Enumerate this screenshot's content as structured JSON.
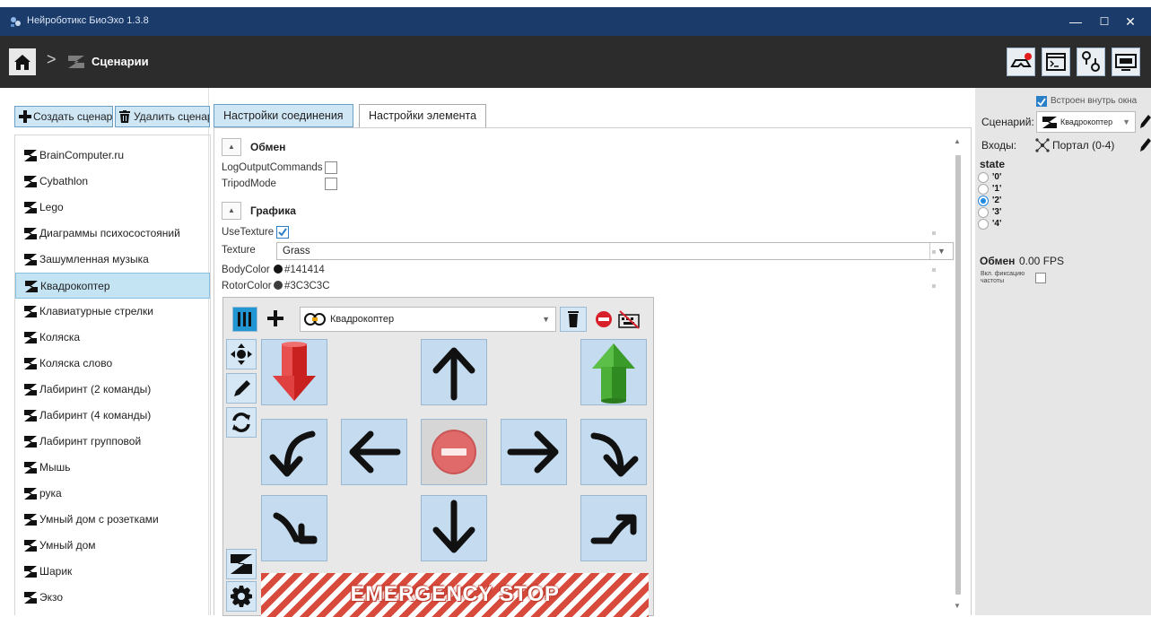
{
  "window": {
    "title": "Нейроботикс БиоЭхо 1.3.8",
    "minimize_glyph": "—",
    "maximize_glyph": "☐",
    "close_glyph": "✕"
  },
  "header": {
    "breadcrumb_separator": ">",
    "breadcrumb_title": "Сценарии",
    "home_icon": "home-icon",
    "buttons": [
      "vr-headset-icon",
      "console-icon",
      "connection-icon",
      "monitor-icon"
    ]
  },
  "sidebar": {
    "create_label": "Создать сценарий",
    "delete_label": "Удалить сценарий",
    "items": [
      {
        "label": "BrainComputer.ru"
      },
      {
        "label": "Cybathlon"
      },
      {
        "label": "Lego"
      },
      {
        "label": "Диаграммы психосостояний"
      },
      {
        "label": "Зашумленная музыка"
      },
      {
        "label": "Квадрокоптер"
      },
      {
        "label": "Клавиатурные стрелки"
      },
      {
        "label": "Коляска"
      },
      {
        "label": "Коляска слово"
      },
      {
        "label": "Лабиринт (2 команды)"
      },
      {
        "label": "Лабиринт (4 команды)"
      },
      {
        "label": "Лабиринт групповой"
      },
      {
        "label": "Мышь"
      },
      {
        "label": "рука"
      },
      {
        "label": "Умный дом с розетками"
      },
      {
        "label": "Умный дом"
      },
      {
        "label": "Шарик"
      },
      {
        "label": "Экзо"
      }
    ],
    "selected_index": 5
  },
  "tabs": {
    "connection": "Настройки соединения",
    "element": "Настройки элемента",
    "active": "element"
  },
  "settings": {
    "section_exchange": "Обмен",
    "log_output_commands": "LogOutputCommands",
    "tripod_mode": "TripodMode",
    "section_graphics": "Графика",
    "use_texture": "UseTexture",
    "use_texture_checked": true,
    "texture_label": "Texture",
    "texture_value": "Grass",
    "body_color_label": "BodyColor",
    "body_color_value": "#141414",
    "rotor_color_label": "RotorColor",
    "rotor_color_value": "#3C3C3C"
  },
  "control_panel": {
    "device_label": "Квадрокоптер",
    "emergency_stop_label": "EMERGENCY STOP"
  },
  "right_panel": {
    "embed_label": "Встроен внутрь окна",
    "embed_checked": true,
    "scenario_label": "Сценарий:",
    "scenario_value": "Квадрокоптер",
    "inputs_label": "Входы:",
    "inputs_value": "Портал (0-4)",
    "state_label": "state",
    "states": [
      "'0'",
      "'1'",
      "'2'",
      "'3'",
      "'4'"
    ],
    "selected_state": 2,
    "exchange_label": "Обмен",
    "fps_value": "0.00 FPS",
    "fix_freq_line1": "Вкл. фиксацию",
    "fix_freq_line2": "частоты"
  }
}
